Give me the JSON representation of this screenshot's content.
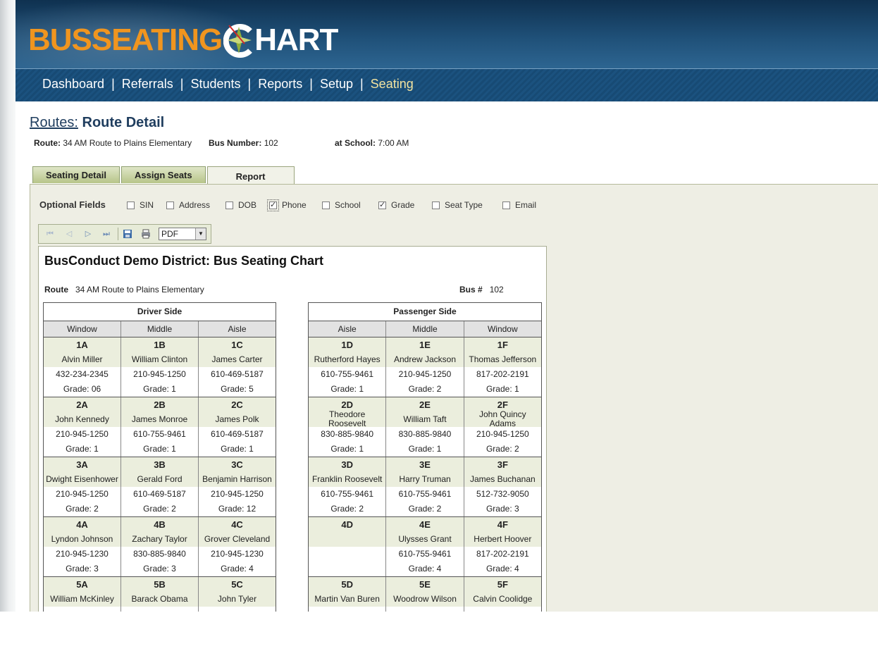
{
  "brand": {
    "part1": "BUSSEATING",
    "part2": "HART",
    "accent": "#f0951f"
  },
  "nav": [
    {
      "label": "Dashboard",
      "active": false
    },
    {
      "label": "Referrals",
      "active": false
    },
    {
      "label": "Students",
      "active": false
    },
    {
      "label": "Reports",
      "active": false
    },
    {
      "label": "Setup",
      "active": false
    },
    {
      "label": "Seating",
      "active": true
    }
  ],
  "nav_separator": "|",
  "page": {
    "breadcrumb": "Routes:",
    "title": "Route Detail"
  },
  "route_info": {
    "route_label": "Route:",
    "route_value": "34 AM Route to Plains Elementary",
    "bus_label": "Bus Number:",
    "bus_value": "102",
    "school_label": "at School:",
    "school_value": "7:00 AM"
  },
  "tabs": [
    {
      "label": "Seating Detail",
      "active": false
    },
    {
      "label": "Assign Seats",
      "active": false
    },
    {
      "label": "Report",
      "active": true
    }
  ],
  "optional_fields": {
    "label": "Optional Fields",
    "items": [
      {
        "label": "SIN",
        "checked": false
      },
      {
        "label": "Address",
        "checked": false
      },
      {
        "label": "DOB",
        "checked": false
      },
      {
        "label": "Phone",
        "checked": true
      },
      {
        "label": "School",
        "checked": false
      },
      {
        "label": "Grade",
        "checked": true
      },
      {
        "label": "Seat Type",
        "checked": false
      },
      {
        "label": "Email",
        "checked": false
      }
    ]
  },
  "toolbar": {
    "format": "PDF"
  },
  "report": {
    "title": "BusConduct Demo District: Bus Seating Chart",
    "route_label": "Route",
    "route_value": "34 AM Route to Plains Elementary",
    "bus_label": "Bus #",
    "bus_value": "102",
    "driver_side": {
      "title": "Driver Side",
      "columns": [
        "Window",
        "Middle",
        "Aisle"
      ],
      "rows": [
        [
          {
            "seat": "1A",
            "name": "Alvin Miller",
            "phone": "432-234-2345",
            "grade": "Grade: 06"
          },
          {
            "seat": "1B",
            "name": "William Clinton",
            "phone": "210-945-1250",
            "grade": "Grade: 1"
          },
          {
            "seat": "1C",
            "name": "James  Carter",
            "phone": "610-469-5187",
            "grade": "Grade: 5"
          }
        ],
        [
          {
            "seat": "2A",
            "name": "John Kennedy",
            "phone": "210-945-1250",
            "grade": "Grade: 1"
          },
          {
            "seat": "2B",
            "name": "James Monroe",
            "phone": "610-755-9461",
            "grade": "Grade: 1"
          },
          {
            "seat": "2C",
            "name": "James Polk",
            "phone": "610-469-5187",
            "grade": "Grade: 1"
          }
        ],
        [
          {
            "seat": "3A",
            "name": "Dwight Eisenhower",
            "phone": "210-945-1250",
            "grade": "Grade: 2"
          },
          {
            "seat": "3B",
            "name": "Gerald Ford",
            "phone": "610-469-5187",
            "grade": "Grade: 2"
          },
          {
            "seat": "3C",
            "name": "Benjamin Harrison",
            "phone": "210-945-1250",
            "grade": "Grade: 12"
          }
        ],
        [
          {
            "seat": "4A",
            "name": "Lyndon Johnson",
            "phone": "210-945-1230",
            "grade": "Grade: 3"
          },
          {
            "seat": "4B",
            "name": "Zachary Taylor",
            "phone": "830-885-9840",
            "grade": "Grade: 3"
          },
          {
            "seat": "4C",
            "name": "Grover Cleveland",
            "phone": "210-945-1230",
            "grade": "Grade: 4"
          }
        ],
        [
          {
            "seat": "5A",
            "name": "William McKinley",
            "phone": "",
            "grade": ""
          },
          {
            "seat": "5B",
            "name": "Barack Obama",
            "phone": "",
            "grade": ""
          },
          {
            "seat": "5C",
            "name": "John Tyler",
            "phone": "",
            "grade": ""
          }
        ]
      ]
    },
    "passenger_side": {
      "title": "Passenger Side",
      "columns": [
        "Aisle",
        "Middle",
        "Window"
      ],
      "rows": [
        [
          {
            "seat": "1D",
            "name": "Rutherford Hayes",
            "phone": "610-755-9461",
            "grade": "Grade: 1"
          },
          {
            "seat": "1E",
            "name": "Andrew  Jackson",
            "phone": "210-945-1250",
            "grade": "Grade: 2"
          },
          {
            "seat": "1F",
            "name": "Thomas Jefferson",
            "phone": "817-202-2191",
            "grade": "Grade: 1"
          }
        ],
        [
          {
            "seat": "2D",
            "name": "Theodore Roosevelt",
            "phone": "830-885-9840",
            "grade": "Grade: 1"
          },
          {
            "seat": "2E",
            "name": "William Taft",
            "phone": "830-885-9840",
            "grade": "Grade: 1"
          },
          {
            "seat": "2F",
            "name": "John Quincy Adams",
            "phone": "210-945-1250",
            "grade": "Grade: 2"
          }
        ],
        [
          {
            "seat": "3D",
            "name": "Franklin Roosevelt",
            "phone": "610-755-9461",
            "grade": "Grade: 2"
          },
          {
            "seat": "3E",
            "name": "Harry Truman",
            "phone": "610-755-9461",
            "grade": "Grade: 2"
          },
          {
            "seat": "3F",
            "name": "James Buchanan",
            "phone": "512-732-9050",
            "grade": "Grade: 3"
          }
        ],
        [
          {
            "seat": "4D",
            "name": "",
            "phone": "",
            "grade": ""
          },
          {
            "seat": "4E",
            "name": "Ulysses Grant",
            "phone": "610-755-9461",
            "grade": "Grade: 4"
          },
          {
            "seat": "4F",
            "name": "Herbert Hoover",
            "phone": "817-202-2191",
            "grade": "Grade: 4"
          }
        ],
        [
          {
            "seat": "5D",
            "name": "Martin Van Buren",
            "phone": "",
            "grade": ""
          },
          {
            "seat": "5E",
            "name": "Woodrow Wilson",
            "phone": "",
            "grade": ""
          },
          {
            "seat": "5F",
            "name": "Calvin Coolidge",
            "phone": "",
            "grade": ""
          }
        ]
      ]
    }
  }
}
